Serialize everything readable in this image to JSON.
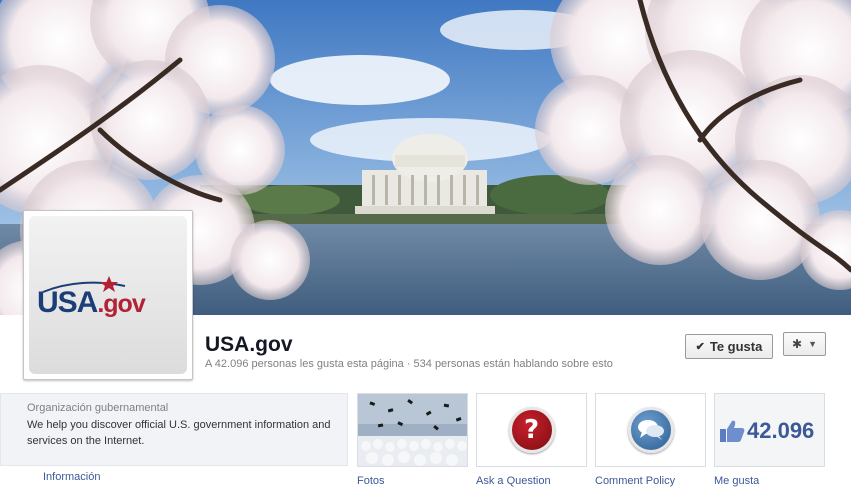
{
  "page": {
    "name": "USA.gov",
    "stats": "A 42.096 personas les gusta esta página · 534 personas están hablando sobre esto"
  },
  "logo": {
    "usa": "USA",
    "gov": ".gov"
  },
  "actions": {
    "like_label": "Te gusta",
    "check_icon": "✔",
    "gear_icon": "✱",
    "caret_icon": "▼"
  },
  "about": {
    "category": "Organización gubernamental",
    "description": "We help you discover official U.S. government information and services on the Internet.",
    "link": "Información"
  },
  "apps": [
    {
      "label": "Fotos",
      "icon": "photo-thumbnail"
    },
    {
      "label": "Ask a Question",
      "icon": "question-icon",
      "glyph": "?"
    },
    {
      "label": "Comment Policy",
      "icon": "speech-bubbles-icon"
    },
    {
      "label": "Me gusta",
      "icon": "thumbs-up-icon",
      "count": "42.096"
    }
  ],
  "colors": {
    "link": "#3b5998",
    "brand_blue": "#1c3e77",
    "brand_red": "#b22234"
  }
}
